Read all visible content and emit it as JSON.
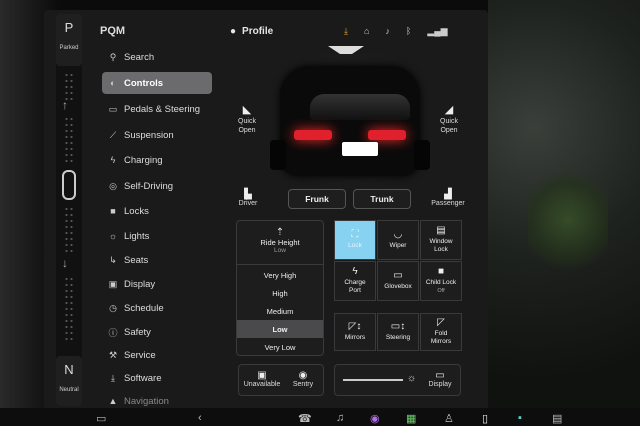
{
  "gear": {
    "top_letter": "P",
    "top_label": "Parked",
    "bottom_letter": "N",
    "bottom_label": "Neutral"
  },
  "sidebar": {
    "title": "PQM",
    "items": [
      {
        "label": "Search",
        "icon": "search-icon"
      },
      {
        "label": "Controls",
        "icon": "toggle-icon"
      },
      {
        "label": "Pedals & Steering",
        "icon": "car-icon"
      },
      {
        "label": "Suspension",
        "icon": "wrench-icon"
      },
      {
        "label": "Charging",
        "icon": "bolt-icon"
      },
      {
        "label": "Self-Driving",
        "icon": "steering-icon"
      },
      {
        "label": "Locks",
        "icon": "lock-icon"
      },
      {
        "label": "Lights",
        "icon": "sun-icon"
      },
      {
        "label": "Seats",
        "icon": "seat-icon"
      },
      {
        "label": "Display",
        "icon": "display-icon"
      },
      {
        "label": "Schedule",
        "icon": "clock-icon"
      },
      {
        "label": "Safety",
        "icon": "warning-icon"
      },
      {
        "label": "Service",
        "icon": "wrench-icon"
      },
      {
        "label": "Software",
        "icon": "download-icon"
      },
      {
        "label": "Navigation",
        "icon": "navigation-icon"
      }
    ]
  },
  "header": {
    "profile_label": "Profile"
  },
  "vehicle": {
    "quick_open_left": "Quick\nOpen",
    "quick_open_right": "Quick\nOpen",
    "frunk": "Frunk",
    "trunk": "Trunk",
    "driver": "Driver",
    "passenger": "Passenger"
  },
  "ride_height": {
    "title": "Ride Height",
    "value": "Low",
    "options": [
      "Very High",
      "High",
      "Medium",
      "Low",
      "Very Low"
    ],
    "selected": "Low"
  },
  "controls": {
    "lock": "Lock",
    "wiper": "Wiper",
    "window_lock": "Window\nLock",
    "charge_port": "Charge\nPort",
    "glovebox": "Glovebox",
    "child_lock": "Child Lock",
    "child_lock_state": "Off",
    "mirrors": "Mirrors",
    "steering": "Steering",
    "fold_mirrors": "Fold\nMirrors",
    "unavailable": "Unavailable",
    "sentry": "Sentry",
    "display": "Display"
  },
  "colors": {
    "accent_lit": "#86d2f0",
    "download": "#e8a43a",
    "taillight": "#e0202c"
  }
}
